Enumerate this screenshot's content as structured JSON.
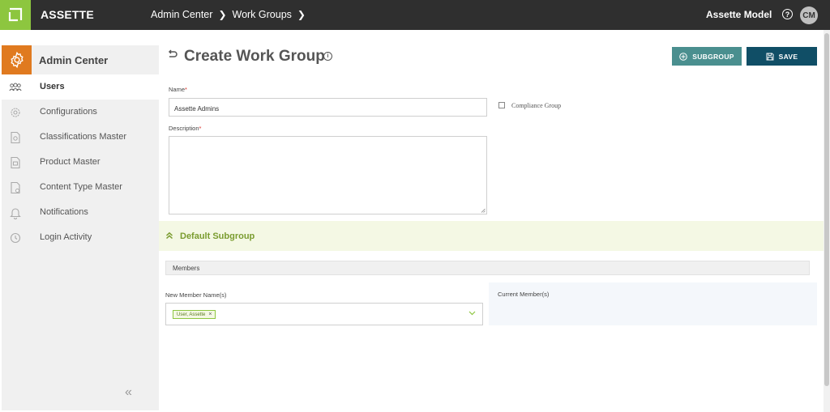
{
  "topbar": {
    "brand": "ASSETTE",
    "breadcrumbs": [
      "Admin Center",
      "Work Groups"
    ],
    "model": "Assette Model",
    "help_glyph": "?",
    "avatar_initials": "CM"
  },
  "sidebar": {
    "title": "Admin Center",
    "items": [
      {
        "label": "Users",
        "icon": "users-icon",
        "active": true
      },
      {
        "label": "Configurations",
        "icon": "gear-icon",
        "active": false
      },
      {
        "label": "Classifications Master",
        "icon": "classification-doc-icon",
        "active": false
      },
      {
        "label": "Product Master",
        "icon": "product-doc-icon",
        "active": false
      },
      {
        "label": "Content Type Master",
        "icon": "content-type-icon",
        "active": false
      },
      {
        "label": "Notifications",
        "icon": "bell-icon",
        "active": false
      },
      {
        "label": "Login Activity",
        "icon": "clock-icon",
        "active": false
      }
    ],
    "collapse_glyph": "«"
  },
  "main": {
    "title": "Create Work Group",
    "info_glyph": "i",
    "buttons": {
      "subgroup": "SUBGROUP",
      "save": "SAVE"
    },
    "name_label": "Name",
    "name_value": "Assette Admins",
    "description_label": "Description",
    "required_mark": "*",
    "compliance_label": "Compliance Group",
    "default_subgroup": "Default Subgroup",
    "members_label": "Members",
    "new_member_label": "New Member Name(s)",
    "member_tag": "User, Assette",
    "tag_remove_glyph": "×",
    "current_members_label": "Current Member(s)"
  },
  "colors": {
    "topbar": "#2f2f2f",
    "logo": "#8dc63f",
    "admin_icon": "#e07a1f",
    "subgroup_button": "#4a8f8f",
    "save_button": "#104e66",
    "subgroup_title": "#7a9c2f"
  }
}
